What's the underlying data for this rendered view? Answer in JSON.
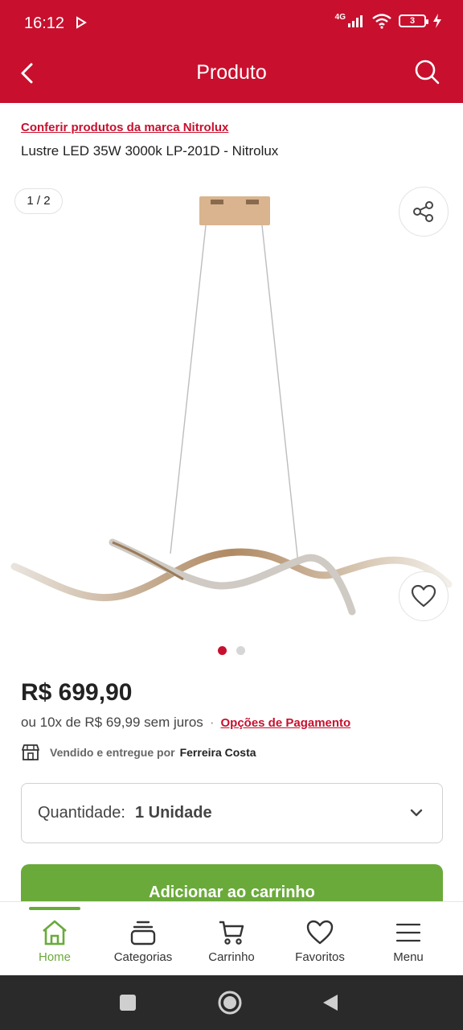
{
  "status_bar": {
    "time": "16:12",
    "network": "4G",
    "battery": "3"
  },
  "header": {
    "title": "Produto"
  },
  "product": {
    "brand_link": "Conferir produtos da marca Nitrolux",
    "title": "Lustre LED 35W 3000k LP-201D - Nitrolux",
    "image_counter": "1 / 2",
    "price": "R$ 699,90",
    "installments": "ou 10x de R$ 69,99 sem juros",
    "separator": "·",
    "payment_options": "Opções de Pagamento",
    "seller_label": "Vendido e entregue por",
    "seller_name": "Ferreira Costa"
  },
  "quantity": {
    "label": "Quantidade:",
    "value": "1 Unidade"
  },
  "add_to_cart_label": "Adicionar ao carrinho",
  "nav": [
    {
      "label": "Home",
      "icon": "home-icon",
      "active": true
    },
    {
      "label": "Categorias",
      "icon": "categories-icon"
    },
    {
      "label": "Carrinho",
      "icon": "cart-icon"
    },
    {
      "label": "Favoritos",
      "icon": "heart-icon"
    },
    {
      "label": "Menu",
      "icon": "menu-icon"
    }
  ],
  "colors": {
    "brand_red": "#c8102e",
    "accent_green": "#6aaa3a"
  },
  "gallery": {
    "total_images": 2,
    "active_index": 0
  }
}
